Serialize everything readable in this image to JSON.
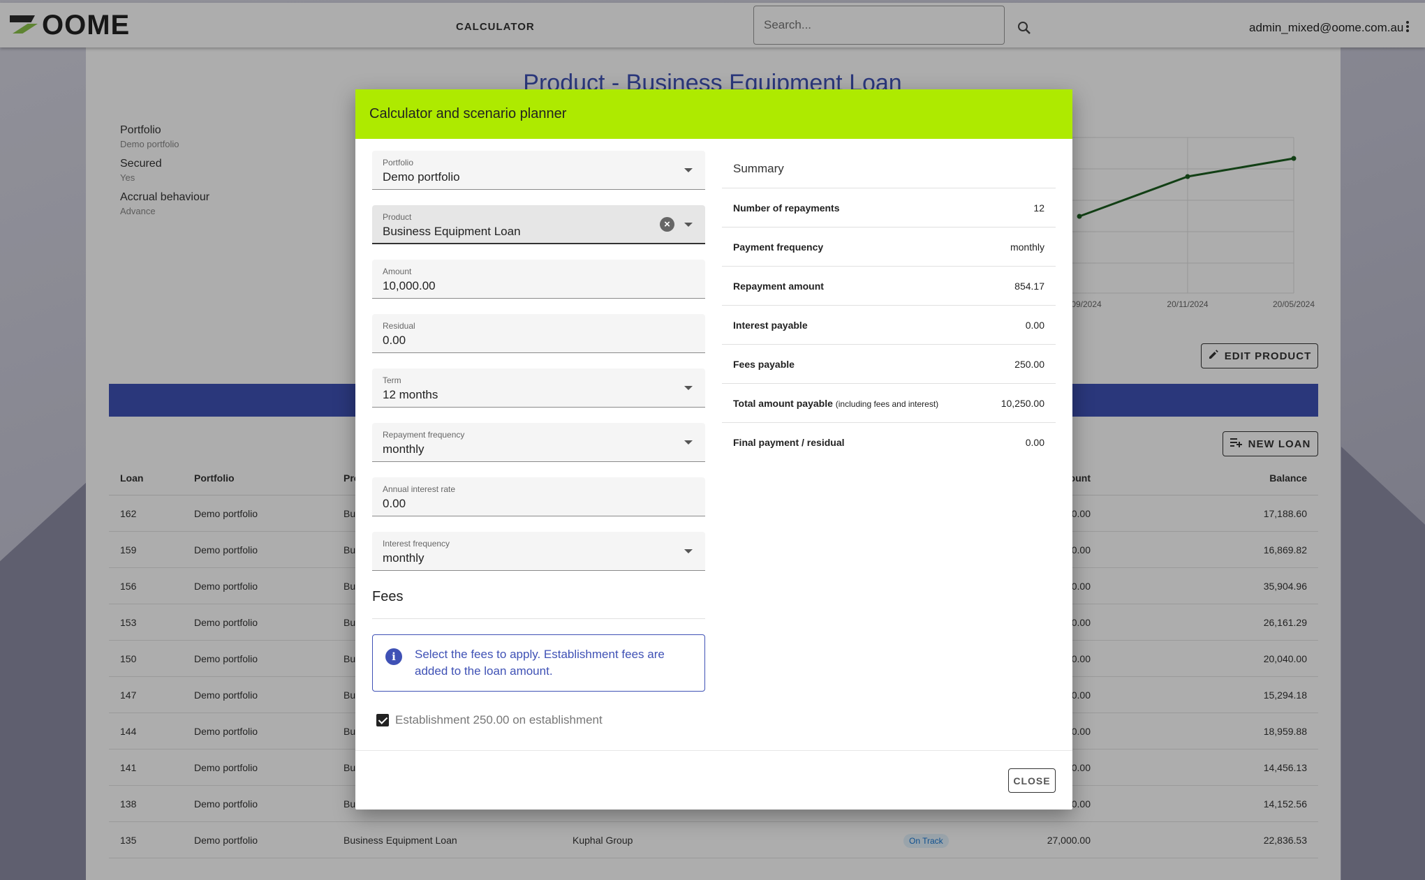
{
  "app": {
    "logo_text": "OOME",
    "nav_calculator": "CALCULATOR",
    "search_placeholder": "Search...",
    "user_email": "admin_mixed@oome.com.au"
  },
  "page": {
    "title": "Product - Business Equipment Loan",
    "attributes": [
      {
        "label": "Portfolio",
        "value": "Demo portfolio"
      },
      {
        "label": "Secured",
        "value": "Yes"
      },
      {
        "label": "Accrual behaviour",
        "value": "Advance"
      }
    ],
    "chart_dates": [
      "09/2024",
      "20/11/2024",
      "20/05/2024"
    ],
    "edit_product_label": "EDIT PRODUCT",
    "new_loan_label": "NEW LOAN"
  },
  "loans": {
    "columns": {
      "loan": "Loan",
      "portfolio": "Portfolio",
      "product": "Pro",
      "amount": "ount",
      "balance": "Balance"
    },
    "rows": [
      {
        "loan": "162",
        "portfolio": "Demo portfolio",
        "product": "Bu",
        "amount": "0.00",
        "balance": "17,188.60"
      },
      {
        "loan": "159",
        "portfolio": "Demo portfolio",
        "product": "Bu",
        "amount": "0.00",
        "balance": "16,869.82"
      },
      {
        "loan": "156",
        "portfolio": "Demo portfolio",
        "product": "Bu",
        "amount": "0.00",
        "balance": "35,904.96"
      },
      {
        "loan": "153",
        "portfolio": "Demo portfolio",
        "product": "Bu",
        "amount": "0.00",
        "balance": "26,161.29"
      },
      {
        "loan": "150",
        "portfolio": "Demo portfolio",
        "product": "Bu",
        "amount": "0.00",
        "balance": "20,040.00"
      },
      {
        "loan": "147",
        "portfolio": "Demo portfolio",
        "product": "Bu",
        "amount": "0.00",
        "balance": "15,294.18"
      },
      {
        "loan": "144",
        "portfolio": "Demo portfolio",
        "product": "Bu",
        "amount": "0.00",
        "balance": "18,959.88"
      },
      {
        "loan": "141",
        "portfolio": "Demo portfolio",
        "product": "Bu",
        "amount": "0.00",
        "balance": "14,456.13"
      },
      {
        "loan": "138",
        "portfolio": "Demo portfolio",
        "product": "Bu",
        "amount": "0.00",
        "balance": "14,152.56"
      },
      {
        "loan": "135",
        "portfolio": "Demo portfolio",
        "product": "Business Equipment Loan",
        "customer": "Kuphal Group",
        "status": "On Track",
        "amount": "27,000.00",
        "balance": "22,836.53"
      }
    ]
  },
  "modal": {
    "title": "Calculator and scenario planner",
    "fields": {
      "portfolio": {
        "label": "Portfolio",
        "value": "Demo portfolio"
      },
      "product": {
        "label": "Product",
        "value": "Business Equipment Loan"
      },
      "amount": {
        "label": "Amount",
        "value": "10,000.00"
      },
      "residual": {
        "label": "Residual",
        "value": "0.00"
      },
      "term": {
        "label": "Term",
        "value": "12 months"
      },
      "repayment_frequency": {
        "label": "Repayment frequency",
        "value": "monthly"
      },
      "annual_interest_rate": {
        "label": "Annual interest rate",
        "value": "0.00"
      },
      "interest_frequency": {
        "label": "Interest frequency",
        "value": "monthly"
      }
    },
    "fees_title": "Fees",
    "fees_info": "Select the fees to apply. Establishment fees are added to the loan amount.",
    "fee_option": "Establishment 250.00 on establishment",
    "fee_checked": true,
    "summary": {
      "title": "Summary",
      "number_of_repayments": {
        "label": "Number of repayments",
        "value": "12"
      },
      "payment_frequency": {
        "label": "Payment frequency",
        "value": "monthly"
      },
      "repayment_amount": {
        "label": "Repayment amount",
        "value": "854.17"
      },
      "interest_payable": {
        "label": "Interest payable",
        "value": "0.00"
      },
      "fees_payable": {
        "label": "Fees payable",
        "value": "250.00"
      },
      "total_amount_payable": {
        "label": "Total amount payable",
        "note": "(including fees and interest)",
        "value": "10,250.00"
      },
      "final_payment": {
        "label": "Final payment / residual",
        "value": "0.00"
      }
    },
    "close_label": "CLOSE"
  },
  "colors": {
    "accent_header": "#aeea00",
    "primary": "#3f51b5",
    "chart_line": "#1b5e20"
  }
}
